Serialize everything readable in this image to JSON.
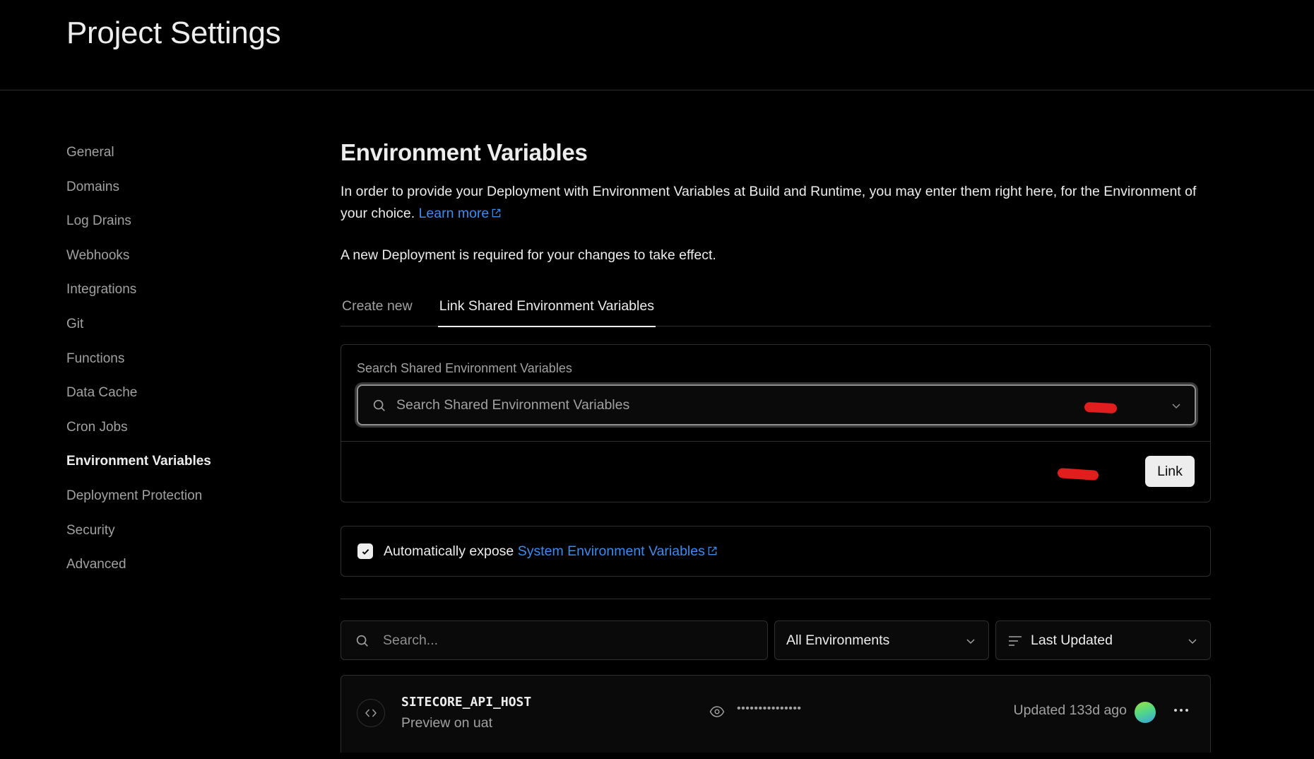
{
  "header": {
    "title": "Project Settings"
  },
  "sidebar": {
    "items": [
      {
        "label": "General",
        "active": false
      },
      {
        "label": "Domains",
        "active": false
      },
      {
        "label": "Log Drains",
        "active": false
      },
      {
        "label": "Webhooks",
        "active": false
      },
      {
        "label": "Integrations",
        "active": false
      },
      {
        "label": "Git",
        "active": false
      },
      {
        "label": "Functions",
        "active": false
      },
      {
        "label": "Data Cache",
        "active": false
      },
      {
        "label": "Cron Jobs",
        "active": false
      },
      {
        "label": "Environment Variables",
        "active": true
      },
      {
        "label": "Deployment Protection",
        "active": false
      },
      {
        "label": "Security",
        "active": false
      },
      {
        "label": "Advanced",
        "active": false
      }
    ]
  },
  "main": {
    "title": "Environment Variables",
    "description": "In order to provide your Deployment with Environment Variables at Build and Runtime, you may enter them right here, for the Environment of your choice.",
    "learn_more": "Learn more",
    "note": "A new Deployment is required for your changes to take effect.",
    "tabs": [
      {
        "label": "Create new",
        "active": false
      },
      {
        "label": "Link Shared Environment Variables",
        "active": true
      }
    ],
    "link_shared": {
      "field_label": "Search Shared Environment Variables",
      "search_placeholder": "Search Shared Environment Variables",
      "link_button": "Link",
      "annotation_color": "#e11d1d"
    },
    "expose": {
      "checked": true,
      "text": "Automatically expose",
      "link": "System Environment Variables"
    },
    "filters": {
      "search_placeholder": "Search...",
      "environment": "All Environments",
      "sort": "Last Updated"
    },
    "variables": [
      {
        "name": "SITECORE_API_HOST",
        "environment": "Preview on uat",
        "value_masked": "•••••••••••••••",
        "updated": "Updated 133d ago"
      }
    ]
  },
  "colors": {
    "background": "#000000",
    "link": "#3b8cf0",
    "text": "#ededed",
    "muted": "#a1a1a1",
    "border": "#2e2e2e"
  }
}
